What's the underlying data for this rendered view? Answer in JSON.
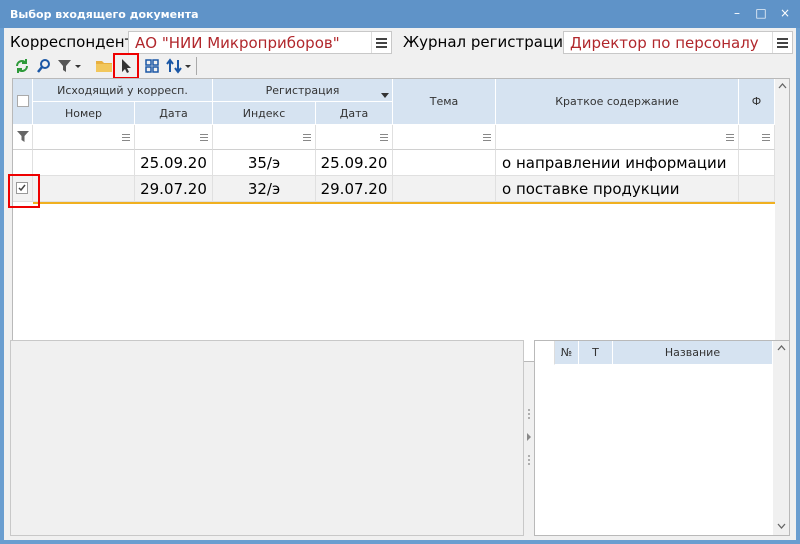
{
  "window": {
    "title": "Выбор входящего документа",
    "controls": [
      "–",
      "□",
      "×"
    ]
  },
  "form": {
    "correspondent_label": "Корреспондент",
    "correspondent_value": "АО \"НИИ Микроприборов\"",
    "journal_label": "Журнал регистрации",
    "journal_value": "Директор по персоналу"
  },
  "toolbar": {
    "icons": [
      "refresh-icon",
      "search-icon",
      "filter-icon",
      "folder-icon",
      "pointer-icon",
      "grid-icon",
      "sort-icon"
    ]
  },
  "grid": {
    "group_headers": [
      "Исходящий у корресп.",
      "Регистрация"
    ],
    "columns": [
      "Номер",
      "Дата",
      "Индекс",
      "Дата",
      "Тема",
      "Краткое содержание",
      "Ф"
    ],
    "rows": [
      {
        "checked": false,
        "number": "",
        "out_date": "25.09.20",
        "index": "35/э",
        "reg_date": "25.09.20",
        "topic": "",
        "summary": "о направлении информации",
        "f": ""
      },
      {
        "checked": true,
        "number": "",
        "out_date": "29.07.20",
        "index": "32/э",
        "reg_date": "29.07.20",
        "topic": "",
        "summary": "о поставке продукции",
        "f": ""
      }
    ]
  },
  "attachments": {
    "columns": [
      "№",
      "Т",
      "Название"
    ]
  },
  "colors": {
    "title_bar": "#5f93c8",
    "header_bg": "#d6e3f1",
    "value_text": "#b1272c",
    "highlight": "#e00000",
    "row_underline": "#f0b020"
  }
}
